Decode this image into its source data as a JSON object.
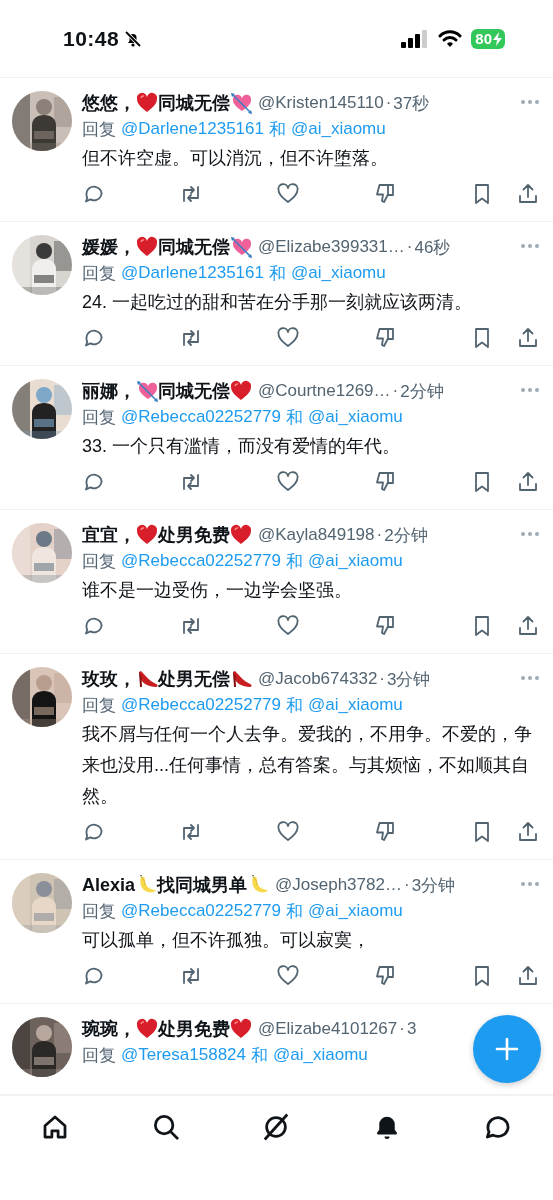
{
  "status_bar": {
    "time": "10:48",
    "silent": true,
    "battery": "80",
    "charging": true
  },
  "tweets": [
    {
      "name": [
        {
          "kind": "text",
          "text": "悠悠，"
        },
        {
          "kind": "heart"
        },
        {
          "kind": "text",
          "text": "同城无偿"
        },
        {
          "kind": "cupid_heart"
        }
      ],
      "handle": "@Kristen145110",
      "dot": "·",
      "time": "37秒",
      "reply_prefix": "回复",
      "mentions": [
        "@Darlene1235161",
        "@ai_xiaomu"
      ],
      "conjunction": "和",
      "text": "但不许空虚。可以消沉，但不许堕落。",
      "more_menu": true
    },
    {
      "name": [
        {
          "kind": "text",
          "text": "媛媛，"
        },
        {
          "kind": "heart"
        },
        {
          "kind": "text",
          "text": "同城无偿"
        },
        {
          "kind": "cupid_heart"
        }
      ],
      "handle": "@Elizabe399331…",
      "dot": "·",
      "time": "46秒",
      "reply_prefix": "回复",
      "mentions": [
        "@Darlene1235161",
        "@ai_xiaomu"
      ],
      "conjunction": "和",
      "text": "24. 一起吃过的甜和苦在分手那一刻就应该两清。",
      "more_menu": true
    },
    {
      "name": [
        {
          "kind": "text",
          "text": "丽娜，"
        },
        {
          "kind": "cupid_heart"
        },
        {
          "kind": "text",
          "text": "同城无偿"
        },
        {
          "kind": "heart"
        }
      ],
      "handle": "@Courtne1269…",
      "dot": "·",
      "time": "2分钟",
      "reply_prefix": "回复",
      "mentions": [
        "@Rebecca02252779",
        "@ai_xiaomu"
      ],
      "conjunction": "和",
      "text": "33. 一个只有滥情，而没有爱情的年代。",
      "more_menu": true
    },
    {
      "name": [
        {
          "kind": "text",
          "text": "宜宜，"
        },
        {
          "kind": "heart"
        },
        {
          "kind": "text",
          "text": "处男免费"
        },
        {
          "kind": "heart"
        }
      ],
      "handle": "@Kayla849198",
      "dot": "·",
      "time": "2分钟",
      "reply_prefix": "回复",
      "mentions": [
        "@Rebecca02252779",
        "@ai_xiaomu"
      ],
      "conjunction": "和",
      "text": "谁不是一边受伤，一边学会坚强。",
      "more_menu": true
    },
    {
      "name": [
        {
          "kind": "text",
          "text": "玫玫，"
        },
        {
          "kind": "heel"
        },
        {
          "kind": "text",
          "text": "处男无偿"
        },
        {
          "kind": "heel"
        }
      ],
      "handle": "@Jacob674332",
      "dot": "·",
      "time": "3分钟",
      "reply_prefix": "回复",
      "mentions": [
        "@Rebecca02252779",
        "@ai_xiaomu"
      ],
      "conjunction": "和",
      "text": "我不屑与任何一个人去争。爱我的，不用争。不爱的，争来也没用...任何事情，总有答案。与其烦恼，不如顺其自然。",
      "more_menu": true
    },
    {
      "name": [
        {
          "kind": "text",
          "text": "Alexia"
        },
        {
          "kind": "banana"
        },
        {
          "kind": "text",
          "text": "找同城男单"
        },
        {
          "kind": "banana"
        }
      ],
      "handle": "@Joseph3782…",
      "dot": "·",
      "time": "3分钟",
      "reply_prefix": "回复",
      "mentions": [
        "@Rebecca02252779",
        "@ai_xiaomu"
      ],
      "conjunction": "和",
      "text": "可以孤单，但不许孤独。可以寂寞，",
      "more_menu": true
    },
    {
      "name": [
        {
          "kind": "text",
          "text": "琬琬，"
        },
        {
          "kind": "heart"
        },
        {
          "kind": "text",
          "text": "处男免费"
        },
        {
          "kind": "heart"
        }
      ],
      "handle": "@Elizabe4101267",
      "dot": "·",
      "time": "3",
      "reply_prefix": "回复",
      "mentions": [
        "@Teresa158824",
        "@ai_xiaomu"
      ],
      "conjunction": "和",
      "more_menu": false
    }
  ],
  "nav": [
    {
      "kind": "home",
      "selected": false
    },
    {
      "kind": "search",
      "selected": false
    },
    {
      "kind": "grok",
      "selected": false
    },
    {
      "kind": "notifications",
      "selected": true
    },
    {
      "kind": "messages",
      "selected": false
    }
  ]
}
